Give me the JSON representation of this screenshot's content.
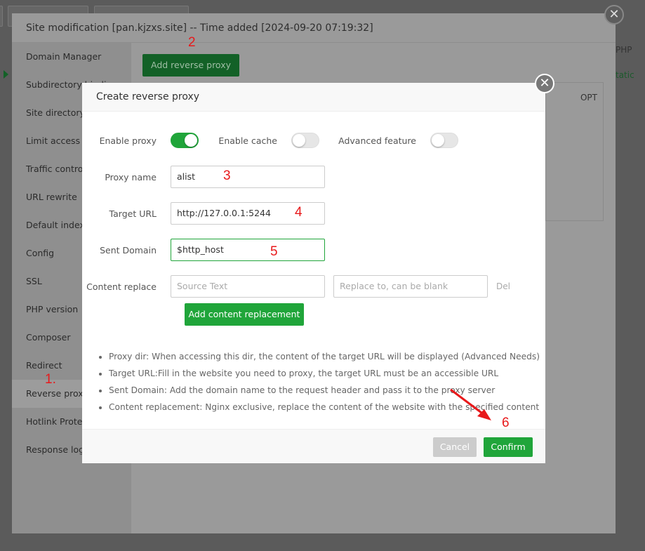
{
  "outer_dialog": {
    "title": "Site modification [pan.kjzxs.site] -- Time added [2024-09-20 07:19:32]",
    "add_button": "Add reverse proxy",
    "table_opt_header": "OPT",
    "bg_php": "PHP",
    "bg_static": "tatic",
    "sidebar": [
      "Domain Manager",
      "Subdirectory binding",
      "Site directory",
      "Limit access",
      "Traffic control",
      "URL rewrite",
      "Default index",
      "Config",
      "SSL",
      "PHP version",
      "Composer",
      "Redirect",
      "Reverse proxy",
      "Hotlink Protection",
      "Response log"
    ],
    "active_item": "Reverse proxy"
  },
  "modal": {
    "title": "Create reverse proxy",
    "enable_proxy": {
      "label": "Enable proxy",
      "on": true
    },
    "enable_cache": {
      "label": "Enable cache",
      "on": false
    },
    "advanced": {
      "label": "Advanced feature",
      "on": false
    },
    "proxy_name": {
      "label": "Proxy name",
      "value": "alist"
    },
    "target_url": {
      "label": "Target URL",
      "value": "http://127.0.0.1:5244"
    },
    "sent_domain": {
      "label": "Sent Domain",
      "value": "$http_host"
    },
    "content_replace": {
      "label": "Content replace",
      "source_placeholder": "Source Text",
      "replace_placeholder": "Replace to, can be blank",
      "del": "Del"
    },
    "add_replacement": "Add content replacement",
    "notes": [
      "Proxy dir: When accessing this dir, the content of the target URL will be displayed (Advanced Needs)",
      "Target URL:Fill in the website you need to proxy, the target URL must be an accessible URL",
      "Sent Domain: Add the domain name to the request header and pass it to the proxy server",
      "Content replacement: Nginx exclusive, replace the content of the website with the specified content"
    ],
    "cancel": "Cancel",
    "confirm": "Confirm"
  },
  "annotations": [
    "1.",
    "2",
    "3",
    "4",
    "5",
    "6"
  ],
  "colors": {
    "accent": "#20a53a",
    "annotation": "#e8191b"
  }
}
